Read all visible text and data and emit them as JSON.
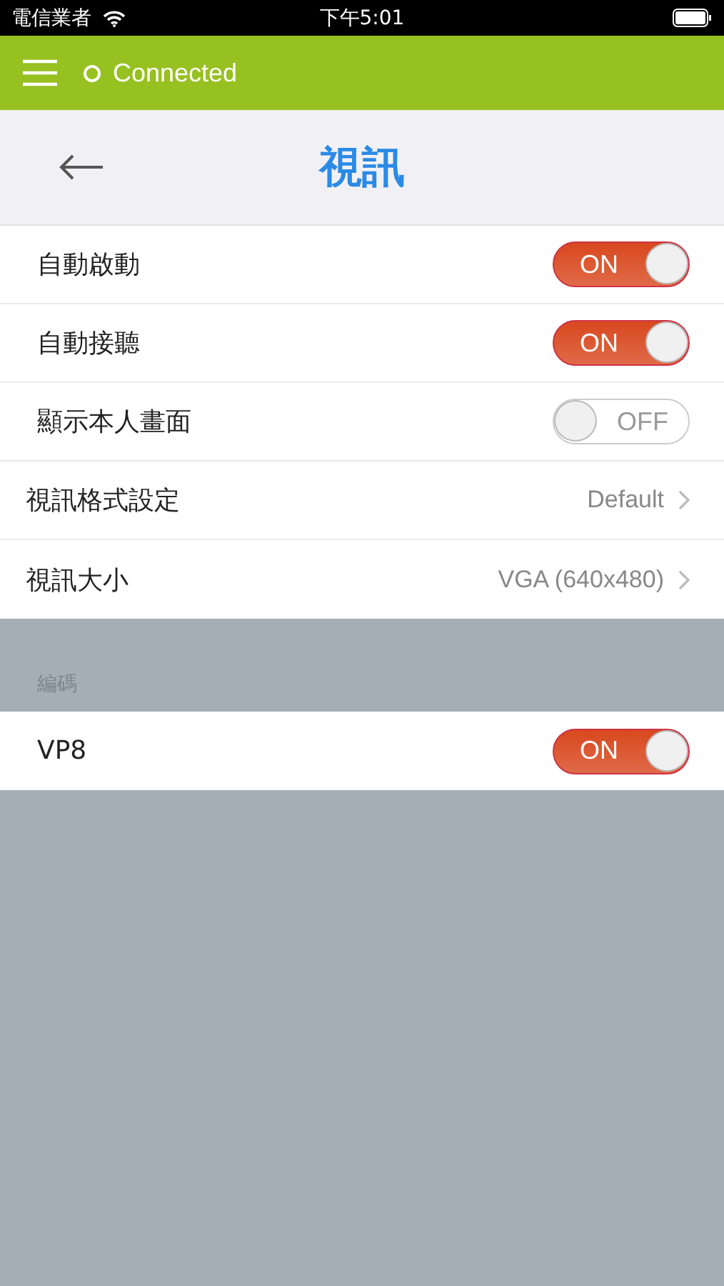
{
  "status_bar": {
    "carrier": "電信業者",
    "time": "下午5:01"
  },
  "app_bar": {
    "status": "Connected"
  },
  "nav": {
    "title": "視訊"
  },
  "sections": [
    {
      "rows": [
        {
          "kind": "toggle",
          "label": "自動啟動",
          "on": true,
          "switch_text": "ON"
        },
        {
          "kind": "toggle",
          "label": "自動接聽",
          "on": true,
          "switch_text": "ON"
        },
        {
          "kind": "toggle",
          "label": "顯示本人畫面",
          "on": false,
          "switch_text": "OFF"
        },
        {
          "kind": "link",
          "label": "視訊格式設定",
          "value": "Default"
        },
        {
          "kind": "link",
          "label": "視訊大小",
          "value": "VGA (640x480)"
        }
      ]
    },
    {
      "header": "編碼",
      "rows": [
        {
          "kind": "toggle",
          "label": "VP8",
          "on": true,
          "switch_text": "ON"
        }
      ]
    }
  ]
}
